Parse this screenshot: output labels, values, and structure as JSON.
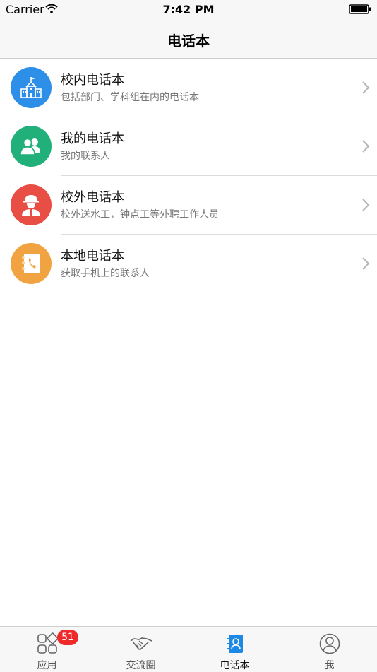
{
  "status_bar": {
    "carrier": "Carrier",
    "time": "7:42 PM"
  },
  "nav": {
    "title": "电话本"
  },
  "rows": [
    {
      "title": "校内电话本",
      "subtitle": "包括部门、学科组在内的电话本",
      "icon": "school-icon",
      "color": "#2d8fe8"
    },
    {
      "title": "我的电话本",
      "subtitle": "我的联系人",
      "icon": "contacts-icon",
      "color": "#22b07a"
    },
    {
      "title": "校外电话本",
      "subtitle": "校外送水工，钟点工等外聘工作人员",
      "icon": "worker-icon",
      "color": "#e84e44"
    },
    {
      "title": "本地电话本",
      "subtitle": "获取手机上的联系人",
      "icon": "phonebook-icon",
      "color": "#f2a341"
    }
  ],
  "tabs": [
    {
      "label": "应用",
      "icon": "apps-grid-icon",
      "badge": "51",
      "active": false
    },
    {
      "label": "交流圈",
      "icon": "handshake-icon",
      "active": false
    },
    {
      "label": "电话本",
      "icon": "address-book-icon",
      "active": true
    },
    {
      "label": "我",
      "icon": "profile-icon",
      "active": false
    }
  ],
  "colors": {
    "accent": "#1e88e5",
    "badge": "#ee2a2a"
  }
}
